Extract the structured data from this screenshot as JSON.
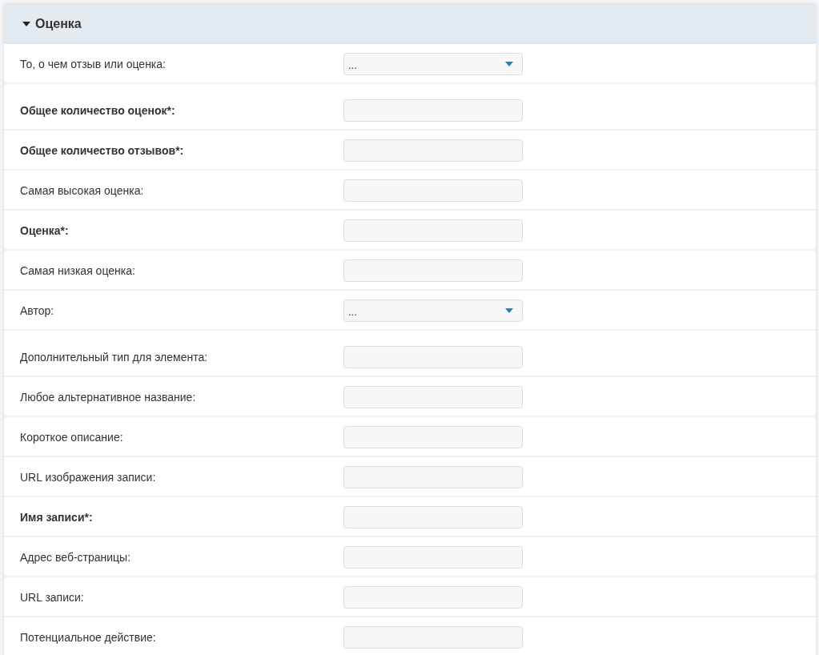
{
  "section": {
    "title": "Оценка",
    "expanded": true
  },
  "fields": [
    {
      "kind": "select",
      "label": "То, о чем отзыв или оценка:",
      "required": false,
      "value": "..."
    },
    {
      "kind": "text",
      "label": "Общее количество оценок*:",
      "required": true
    },
    {
      "kind": "text",
      "label": "Общее количество отзывов*:",
      "required": true
    },
    {
      "kind": "text",
      "label": "Самая высокая оценка:",
      "required": false
    },
    {
      "kind": "text",
      "label": "Оценка*:",
      "required": true
    },
    {
      "kind": "text",
      "label": "Самая низкая оценка:",
      "required": false
    },
    {
      "kind": "select",
      "label": "Автор:",
      "required": false,
      "value": "..."
    },
    {
      "kind": "text",
      "label": "Дополнительный тип для элемента:",
      "required": false
    },
    {
      "kind": "text",
      "label": "Любое альтернативное название:",
      "required": false
    },
    {
      "kind": "text",
      "label": "Короткое описание:",
      "required": false
    },
    {
      "kind": "text",
      "label": "URL изображения записи:",
      "required": false
    },
    {
      "kind": "text",
      "label": "Имя записи*:",
      "required": true
    },
    {
      "kind": "text",
      "label": "Адрес веб-страницы:",
      "required": false
    },
    {
      "kind": "text",
      "label": "URL записи:",
      "required": false
    },
    {
      "kind": "text",
      "label": "Потенциальное действие:",
      "required": false
    }
  ]
}
